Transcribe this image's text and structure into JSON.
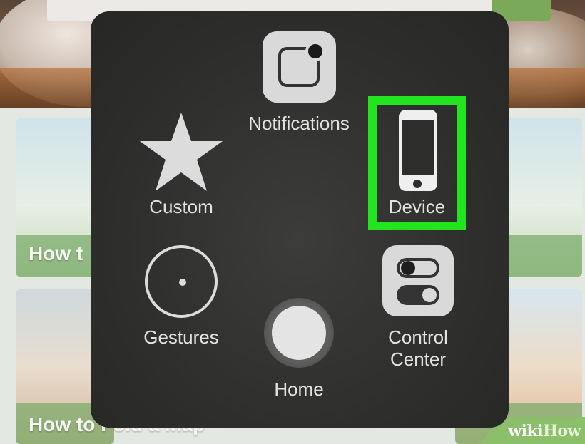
{
  "background": {
    "card_captions": [
      "How t",
      "How to Fold a Map"
    ],
    "watermark": {
      "part1": "wiki",
      "part2": "How"
    }
  },
  "assistive_touch": {
    "items": {
      "notifications": {
        "label": "Notifications",
        "icon": "notifications-icon"
      },
      "custom": {
        "label": "Custom",
        "icon": "star-icon"
      },
      "device": {
        "label": "Device",
        "icon": "iphone-icon",
        "highlighted": true
      },
      "gestures": {
        "label": "Gestures",
        "icon": "gestures-icon"
      },
      "home": {
        "label": "Home",
        "icon": "home-button-icon"
      },
      "control_center": {
        "label_line1": "Control",
        "label_line2": "Center",
        "icon": "control-center-toggles-icon"
      }
    }
  },
  "colors": {
    "highlight": "#22e51f",
    "menu_background": "#2e2e2c",
    "label_text": "#e2e2e2"
  }
}
